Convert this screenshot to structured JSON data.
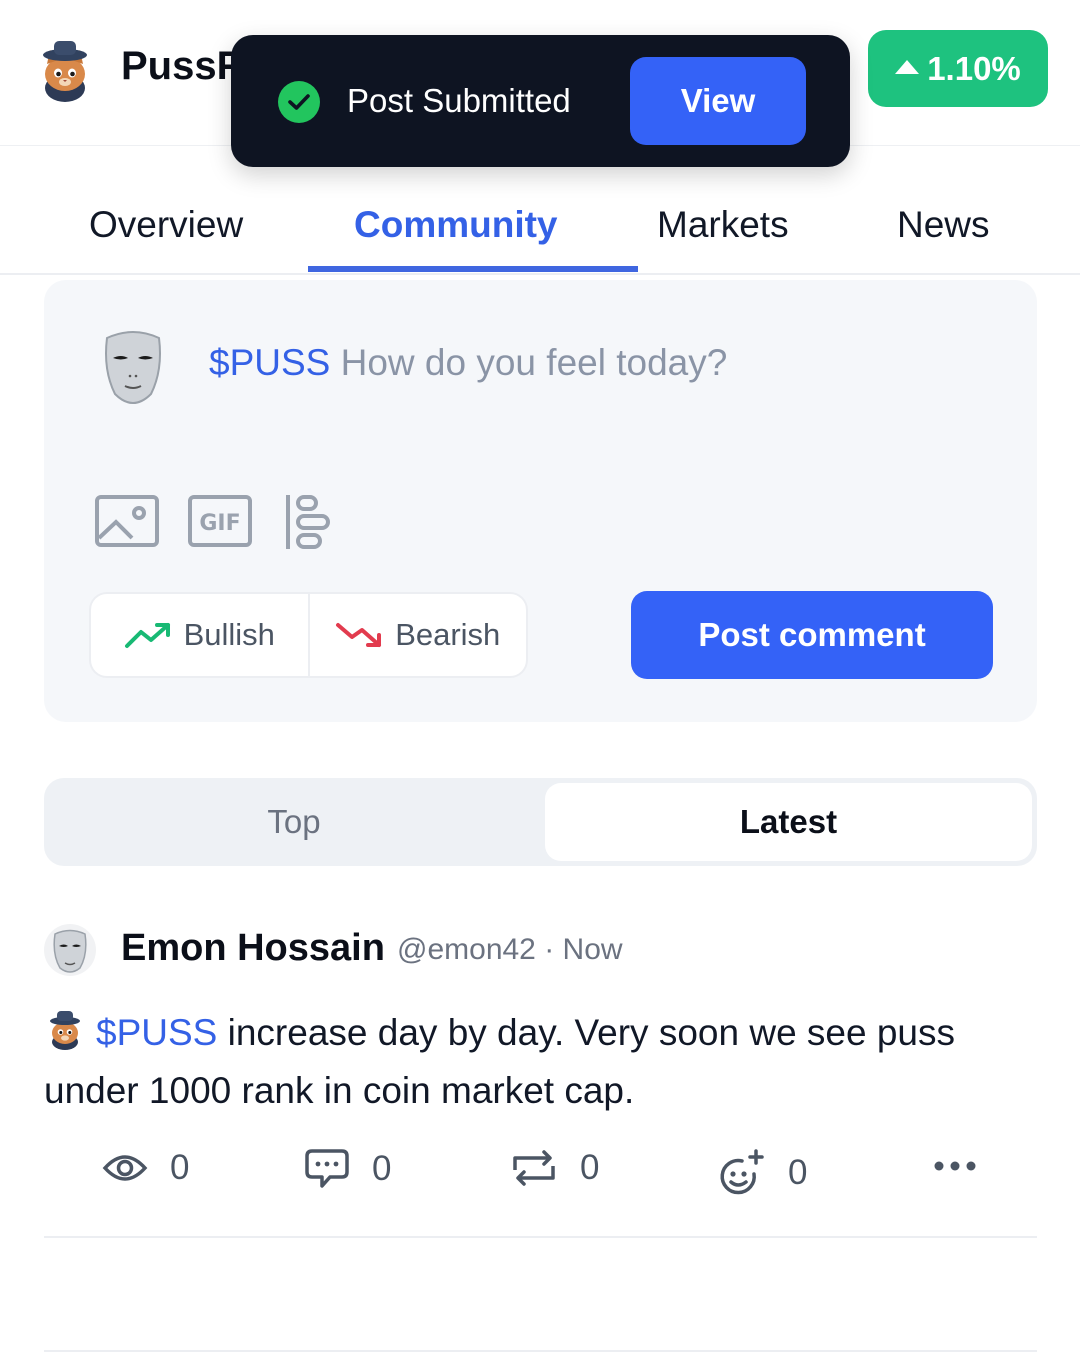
{
  "header": {
    "coin_name": "PussF",
    "price_change": "1.10%",
    "price_change_color": "#1ec27f"
  },
  "toast": {
    "message": "Post Submitted",
    "action_label": "View"
  },
  "tabs": [
    {
      "label": "Overview"
    },
    {
      "label": "Community",
      "active": true
    },
    {
      "label": "Markets"
    },
    {
      "label": "News"
    }
  ],
  "composer": {
    "ticker": "$PUSS",
    "placeholder": "How do you feel today?",
    "tools": [
      "image-icon",
      "gif-icon",
      "poll-icon"
    ],
    "bullish_label": "Bullish",
    "bearish_label": "Bearish",
    "post_label": "Post comment",
    "accent_color": "#3462f7"
  },
  "sort": {
    "top_label": "Top",
    "latest_label": "Latest",
    "selected": "Latest"
  },
  "post": {
    "author": "Emon Hossain",
    "handle": "@emon42",
    "time": "Now",
    "ticker": "$PUSS",
    "body": " increase day by day. Very soon we see puss under 1000 rank in coin market cap.",
    "views": "0",
    "comments": "0",
    "reposts": "0",
    "reactions": "0"
  }
}
